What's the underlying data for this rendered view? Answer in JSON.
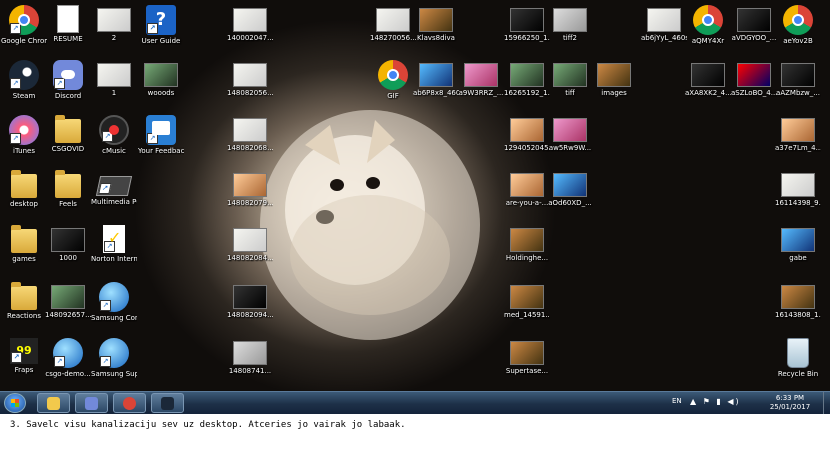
{
  "desktop": {
    "wallpaper": "white pomeranian on bed sheets",
    "icons": [
      {
        "label": "Google Chrome",
        "icon": "chrome-icon",
        "style": "chrome",
        "shortcut": true
      },
      {
        "label": "Steam",
        "icon": "steam-icon",
        "style": "steam",
        "shortcut": true
      },
      {
        "label": "iTunes",
        "icon": "itunes-icon",
        "style": "itunes",
        "shortcut": true
      },
      {
        "label": "desktop",
        "icon": "folder-icon",
        "style": "folder",
        "shortcut": false
      },
      {
        "label": "games",
        "icon": "folder-icon",
        "style": "folder",
        "shortcut": false
      },
      {
        "label": "Reactions",
        "icon": "folder-icon",
        "style": "folder",
        "shortcut": false
      },
      {
        "label": "Fraps",
        "icon": "fraps-icon",
        "style": "fraps",
        "shortcut": true
      },
      {
        "label": "RESUME",
        "icon": "document-icon",
        "style": "doc",
        "shortcut": false
      },
      {
        "label": "Discord",
        "icon": "discord-icon",
        "style": "discord",
        "shortcut": true
      },
      {
        "label": "CSGOVID",
        "icon": "folder-icon",
        "style": "folder",
        "shortcut": false
      },
      {
        "label": "Feels",
        "icon": "folder-icon",
        "style": "folder",
        "shortcut": false
      },
      {
        "label": "1000",
        "icon": "image-thumbnail-icon",
        "style": "thumb c6",
        "shortcut": false
      },
      {
        "label": "148092657...",
        "icon": "image-thumbnail-icon",
        "style": "thumb c4",
        "shortcut": false
      },
      {
        "label": "csgo-demo...",
        "icon": "app-icon",
        "style": "samsung",
        "shortcut": true
      },
      {
        "label": "2",
        "icon": "image-thumbnail-icon",
        "style": "thumb c5",
        "shortcut": false
      },
      {
        "label": "1",
        "icon": "image-thumbnail-icon",
        "style": "thumb c5",
        "shortcut": false
      },
      {
        "label": "cMusic",
        "icon": "cmusic-icon",
        "style": "cmusic",
        "shortcut": true
      },
      {
        "label": "Multimedia POP",
        "icon": "multimedia-icon",
        "style": "multimedia",
        "shortcut": true
      },
      {
        "label": "Norton Intern...",
        "icon": "norton-icon",
        "style": "norton",
        "shortcut": true
      },
      {
        "label": "Samsung Control...",
        "icon": "samsung-icon",
        "style": "samsung",
        "shortcut": true
      },
      {
        "label": "Samsung Suppor...",
        "icon": "samsung-icon",
        "style": "samsung",
        "shortcut": true
      },
      {
        "label": "User Guide",
        "icon": "help-icon",
        "style": "userguide",
        "shortcut": true
      },
      {
        "label": "wooods",
        "icon": "image-thumbnail-icon",
        "style": "thumb c4",
        "shortcut": false
      },
      {
        "label": "Your Feedback...",
        "icon": "feedback-icon",
        "style": "feedback",
        "shortcut": true
      },
      {
        "label": "140002047...",
        "icon": "image-thumbnail-icon",
        "style": "thumb c5",
        "shortcut": false
      },
      {
        "label": "148082056...",
        "icon": "image-thumbnail-icon",
        "style": "thumb c5",
        "shortcut": false
      },
      {
        "label": "148082068...",
        "icon": "image-thumbnail-icon",
        "style": "thumb c5",
        "shortcut": false
      },
      {
        "label": "148082079...",
        "icon": "image-thumbnail-icon",
        "style": "thumb c9",
        "shortcut": false
      },
      {
        "label": "148082084...",
        "icon": "image-thumbnail-icon",
        "style": "thumb c5",
        "shortcut": false
      },
      {
        "label": "148082094...",
        "icon": "image-thumbnail-icon",
        "style": "thumb c6",
        "shortcut": false
      },
      {
        "label": "14808741...",
        "icon": "image-thumbnail-icon",
        "style": "thumb c2",
        "shortcut": false
      },
      {
        "label": "148270056...",
        "icon": "image-thumbnail-icon",
        "style": "thumb c5",
        "shortcut": false
      },
      {
        "label": "GIF",
        "icon": "chrome-icon",
        "style": "chrome",
        "shortcut": false
      },
      {
        "label": "Klavs8diva",
        "icon": "image-thumbnail-icon",
        "style": "thumb c3",
        "shortcut": false
      },
      {
        "label": "ab6P8x8_460s",
        "icon": "image-thumbnail-icon",
        "style": "thumb c8",
        "shortcut": false
      },
      {
        "label": "a9W3RRZ_...",
        "icon": "image-thumbnail-icon",
        "style": "thumb c7",
        "shortcut": false
      },
      {
        "label": "15966250_1...",
        "icon": "image-thumbnail-icon",
        "style": "thumb c6",
        "shortcut": false
      },
      {
        "label": "16265192_1...",
        "icon": "image-thumbnail-icon",
        "style": "thumb c4",
        "shortcut": false
      },
      {
        "label": "1294052045...",
        "icon": "image-thumbnail-icon",
        "style": "thumb c9",
        "shortcut": false
      },
      {
        "label": "are-you-a-...",
        "icon": "image-thumbnail-icon",
        "style": "thumb c9",
        "shortcut": false
      },
      {
        "label": "Holdinghe...",
        "icon": "image-thumbnail-icon",
        "style": "thumb c3",
        "shortcut": false
      },
      {
        "label": "med_14591...",
        "icon": "image-thumbnail-icon",
        "style": "thumb c3",
        "shortcut": false
      },
      {
        "label": "Supertase...",
        "icon": "image-thumbnail-icon",
        "style": "thumb c3",
        "shortcut": false
      },
      {
        "label": "tiff2",
        "icon": "image-thumbnail-icon",
        "style": "thumb c2",
        "shortcut": false
      },
      {
        "label": "tiff",
        "icon": "image-thumbnail-icon",
        "style": "thumb c4",
        "shortcut": false
      },
      {
        "label": "aw5Rw9W...",
        "icon": "image-thumbnail-icon",
        "style": "thumb c7",
        "shortcut": false
      },
      {
        "label": "aOd60XD_...",
        "icon": "image-thumbnail-icon",
        "style": "thumb c8",
        "shortcut": false
      },
      {
        "label": "images",
        "icon": "image-thumbnail-icon",
        "style": "thumb c3",
        "shortcut": false
      },
      {
        "label": "ab6jYyL_460s",
        "icon": "image-thumbnail-icon",
        "style": "thumb c5",
        "shortcut": false
      },
      {
        "label": "aQMY4Xr",
        "icon": "chrome-icon",
        "style": "chrome",
        "shortcut": false
      },
      {
        "label": "aVDGYOO_...",
        "icon": "image-thumbnail-icon",
        "style": "thumb c6",
        "shortcut": false
      },
      {
        "label": "aeYov2B",
        "icon": "chrome-icon",
        "style": "chrome",
        "shortcut": false
      },
      {
        "label": "aXA8XK2_4...",
        "icon": "image-thumbnail-icon",
        "style": "thumb c6",
        "shortcut": false
      },
      {
        "label": "aSZLoBO_4...",
        "icon": "image-thumbnail-icon",
        "style": "thumb c10",
        "shortcut": false
      },
      {
        "label": "aAZMbzw_...",
        "icon": "image-thumbnail-icon",
        "style": "thumb c6",
        "shortcut": false
      },
      {
        "label": "a37e7Lm_4...",
        "icon": "image-thumbnail-icon",
        "style": "thumb c9",
        "shortcut": false
      },
      {
        "label": "16114398_9...",
        "icon": "image-thumbnail-icon",
        "style": "thumb c5",
        "shortcut": false
      },
      {
        "label": "gabe",
        "icon": "image-thumbnail-icon",
        "style": "thumb c8",
        "shortcut": false
      },
      {
        "label": "16143808_1...",
        "icon": "image-thumbnail-icon",
        "style": "thumb c3",
        "shortcut": false
      },
      {
        "label": "Recycle Bin",
        "icon": "recycle-bin-icon",
        "style": "recycle",
        "shortcut": false
      }
    ]
  },
  "taskbar": {
    "pinned": [
      {
        "name": "file-explorer",
        "color": "#f2c94c"
      },
      {
        "name": "discord",
        "color": "#7289da"
      },
      {
        "name": "chrome",
        "color": "#db4437"
      },
      {
        "name": "steam",
        "color": "#1b2838"
      }
    ],
    "tray": {
      "language": "EN",
      "icons": "▲ ⚑ ▮ ◀)",
      "time": "6:33 PM",
      "date": "25/01/2017"
    }
  },
  "caption": "3. Savelc visu kanalizaciju sev uz desktop. Atceries jo vairak jo labaak."
}
